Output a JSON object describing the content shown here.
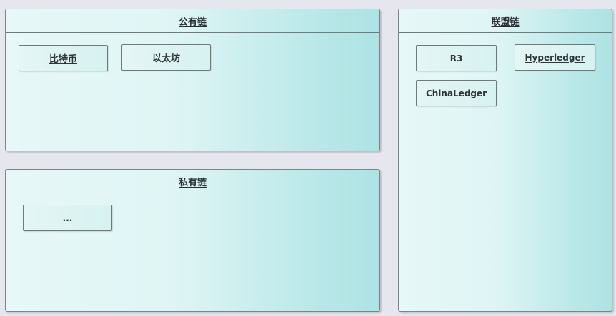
{
  "public_chain": {
    "title": "公有链",
    "items": [
      "比特币",
      "以太坊"
    ]
  },
  "private_chain": {
    "title": "私有链",
    "items": [
      "..."
    ]
  },
  "consortium_chain": {
    "title": "联盟链",
    "items": [
      "R3",
      "Hyperledger",
      "ChinaLedger"
    ]
  }
}
